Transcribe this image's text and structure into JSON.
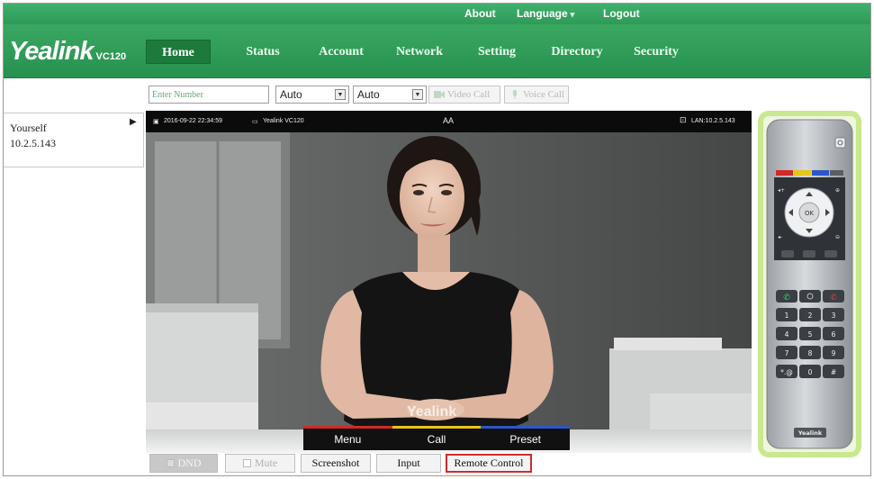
{
  "topbar": {
    "about": "About",
    "language": "Language",
    "logout": "Logout"
  },
  "brand": {
    "logo": "Yealink",
    "model": "VC120"
  },
  "nav": {
    "tabs": [
      {
        "label": "Home",
        "active": true
      },
      {
        "label": "Status"
      },
      {
        "label": "Account"
      },
      {
        "label": "Network"
      },
      {
        "label": "Setting"
      },
      {
        "label": "Directory"
      },
      {
        "label": "Security"
      }
    ]
  },
  "dialbar": {
    "number_placeholder": "Enter Number",
    "select1": "Auto",
    "select2": "Auto",
    "video_call": "Video Call",
    "voice_call": "Voice Call"
  },
  "sidebar": {
    "name": "Yourself",
    "ip": "10.2.5.143"
  },
  "video": {
    "datetime": "2016-09-22 22:34:59",
    "device": "Yealink VC120",
    "center_mark": "AA",
    "lan": "LAN:10.2.5.143",
    "watermark": "Yealink",
    "menu": [
      {
        "label": "Menu",
        "color": "#d02a2a"
      },
      {
        "label": "Call",
        "color": "#e8c51a"
      },
      {
        "label": "Preset",
        "color": "#2b57c9"
      }
    ]
  },
  "controls": {
    "dnd": "DND",
    "mute": "Mute",
    "screenshot": "Screenshot",
    "input": "Input",
    "remote_control": "Remote Control"
  },
  "remote": {
    "ok": "OK",
    "brand": "Yealink",
    "keys": [
      "1",
      "2",
      "3",
      "4",
      "5",
      "6",
      "7",
      "8",
      "9",
      "*.@",
      "0",
      "#"
    ]
  },
  "colors": {
    "brand_green": "#2f9a57",
    "active_tab": "#1c7a3c",
    "highlight_border": "#cc2b2b",
    "remote_glow": "#c9e88f"
  }
}
